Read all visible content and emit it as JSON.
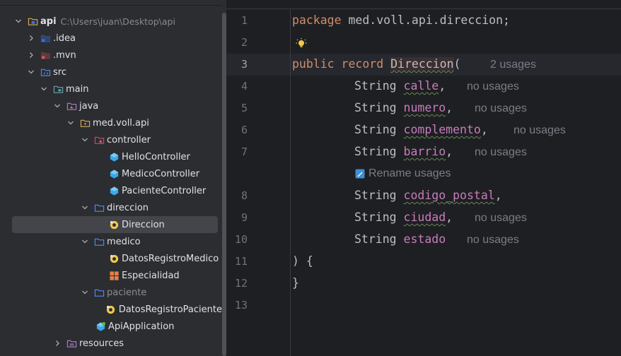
{
  "project": {
    "root_name": "api",
    "root_path": "C:\\Users\\juan\\Desktop\\api",
    "items": [
      {
        "label": "api",
        "icon": "module-folder-icon",
        "expanded": true
      },
      {
        "label": ".idea",
        "icon": "folder-idea-icon",
        "expanded": false
      },
      {
        "label": ".mvn",
        "icon": "folder-mvn-icon",
        "expanded": false
      },
      {
        "label": "src",
        "icon": "source-folder-icon",
        "expanded": true
      },
      {
        "label": "main",
        "icon": "folder-icon",
        "expanded": true
      },
      {
        "label": "java",
        "icon": "java-sources-folder-icon",
        "expanded": true
      },
      {
        "label": "med.voll.api",
        "icon": "package-icon",
        "expanded": true
      },
      {
        "label": "controller",
        "icon": "package-config-icon",
        "expanded": true
      },
      {
        "label": "HelloController",
        "icon": "class-icon"
      },
      {
        "label": "MedicoController",
        "icon": "class-icon"
      },
      {
        "label": "PacienteController",
        "icon": "class-icon"
      },
      {
        "label": "direccion",
        "icon": "package-icon",
        "expanded": true
      },
      {
        "label": "Direccion",
        "icon": "record-icon",
        "selected": true
      },
      {
        "label": "medico",
        "icon": "package-icon",
        "expanded": true
      },
      {
        "label": "DatosRegistroMedico",
        "icon": "record-icon"
      },
      {
        "label": "Especialidad",
        "icon": "enum-icon"
      },
      {
        "label": "paciente",
        "icon": "package-icon",
        "expanded": true
      },
      {
        "label": "DatosRegistroPaciente",
        "icon": "record-icon"
      },
      {
        "label": "ApiApplication",
        "icon": "spring-class-icon"
      },
      {
        "label": "resources",
        "icon": "resources-folder-icon",
        "expanded": false
      }
    ]
  },
  "editor": {
    "line_numbers": [
      "1",
      "2",
      "3",
      "4",
      "5",
      "6",
      "7",
      "8",
      "9",
      "10",
      "11",
      "12",
      "13"
    ],
    "current_line": "3",
    "line1": {
      "kw": "package",
      "rest": " med.voll.api.direccion;"
    },
    "line3": {
      "kw1": "public",
      "kw2": "record",
      "name": "Direccion",
      "paren": "(",
      "hint": "2 usages"
    },
    "fields": [
      {
        "type": "String",
        "name": "calle",
        "punct": ",",
        "hint": "no usages"
      },
      {
        "type": "String",
        "name": "numero",
        "punct": ",",
        "hint": "no usages"
      },
      {
        "type": "String",
        "name": "complemento",
        "punct": ",",
        "hint": "no usages"
      },
      {
        "type": "String",
        "name": "barrio",
        "punct": ",",
        "hint": "no usages"
      },
      {
        "type": "String",
        "name": "codigo_postal",
        "punct": ",",
        "hint": ""
      },
      {
        "type": "String",
        "name": "ciudad",
        "punct": ",",
        "hint": "no usages"
      },
      {
        "type": "String",
        "name": "estado",
        "punct": "",
        "hint": "no usages"
      }
    ],
    "rename_hint": "Rename usages",
    "line11": ") {",
    "line12": "}"
  },
  "colors": {
    "keyword": "#cf8e6d",
    "field": "#c77dbb",
    "text": "#bcbec4",
    "hint": "#7a7e85",
    "panel_bg": "#2b2d30",
    "editor_bg": "#1e1f22"
  }
}
